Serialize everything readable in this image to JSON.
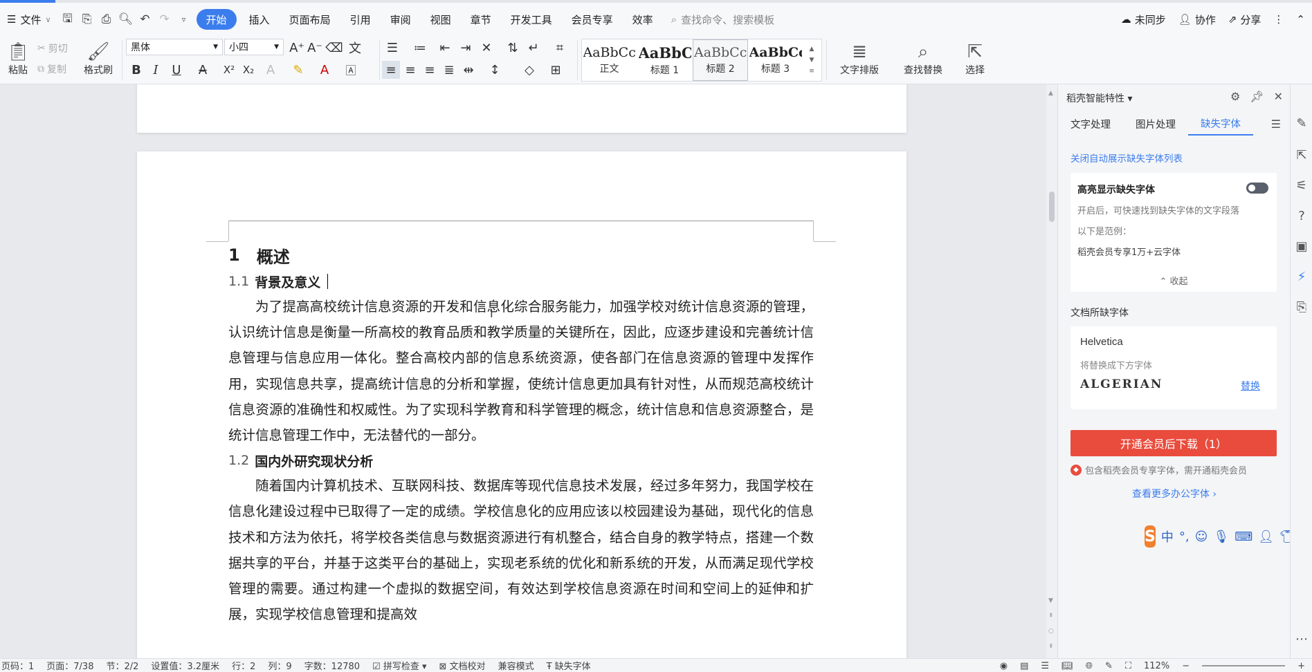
{
  "topbar": {
    "file_label": "文件",
    "tabs": [
      "开始",
      "插入",
      "页面布局",
      "引用",
      "审阅",
      "视图",
      "章节",
      "开发工具",
      "会员专享",
      "效率"
    ],
    "search_placeholder": "查找命令、搜索模板",
    "sync": "未同步",
    "collab": "协作",
    "share": "分享"
  },
  "ribbon": {
    "paste": "粘贴",
    "cut": "剪切",
    "copy": "复制",
    "format_painter": "格式刷",
    "font_name": "黑体",
    "font_size": "小四",
    "styles": [
      {
        "sample": "AaBbCcI",
        "label": "正文"
      },
      {
        "sample": "AaBbCc",
        "label": "标题 1"
      },
      {
        "sample": "AaBbCcD",
        "label": "标题 2"
      },
      {
        "sample": "AaBbCcI",
        "label": "标题 3"
      }
    ],
    "text_layout": "文字排版",
    "find_replace": "查找替换",
    "select": "选择"
  },
  "document": {
    "h1_num": "1",
    "h1_text": "概述",
    "s1_num": "1.1",
    "s1_text": "背景及意义",
    "p1": "为了提高高校统计信息资源的开发和信息化综合服务能力，加强学校对统计信息资源的管理，认识统计信息是衡量一所高校的教育品质和教学质量的关键所在，因此，应逐步建设和完善统计信息管理与信息应用一体化。整合高校内部的信息系统资源，使各部门在信息资源的管理中发挥作用，实现信息共享，提高统计信息的分析和掌握，使统计信息更加具有针对性，从而规范高校统计信息资源的准确性和权威性。为了实现科学教育和科学管理的概念，统计信息和信息资源整合，是统计信息管理工作中，无法替代的一部分。",
    "s2_num": "1.2",
    "s2_text": "国内外研究现状分析",
    "p2": "随着国内计算机技术、互联网科技、数据库等现代信息技术发展，经过多年努力，我国学校在信息化建设过程中已取得了一定的成绩。学校信息化的应用应该以校园建设为基础，现代化的信息技术和方法为依托，将学校各类信息与数据资源进行有机整合，结合自身的教学特点，搭建一个数据共享的平台，并基于这类平台的基础上，实现老系统的优化和新系统的开发，从而满足现代学校管理的需要。通过构建一个虚拟的数据空间，有效达到学校信息资源在时间和空间上的延伸和扩展，实现学校信息管理和提高效"
  },
  "panel": {
    "title": "稻壳智能特性",
    "tabs": [
      "文字处理",
      "图片处理",
      "缺失字体"
    ],
    "close_auto_link": "关闭自动展示缺失字体列表",
    "highlight_title": "高亮显示缺失字体",
    "highlight_desc": "开启后，可快速找到缺失字体的文字段落",
    "example_label": "以下是范例：",
    "example_text": "稻壳会员专享1万+云字体",
    "collapse": "收起",
    "missing_title": "文档所缺字体",
    "missing_font": "Helvetica",
    "replace_hint": "将替换成下方字体",
    "replacement_font": "ALGERIAN",
    "replace_btn": "替换",
    "download_btn": "开通会员后下载（1）",
    "member_note": "包含稻壳会员专享字体，需开通稻壳会员",
    "more_fonts": "查看更多办公字体 ›"
  },
  "ime": {
    "lang": "中"
  },
  "status": {
    "page_no": "页码：1",
    "page_of": "页面：7/38",
    "section": "节：2/2",
    "setting": "设置值：3.2厘米",
    "row": "行：2",
    "col": "列：9",
    "word_count": "字数：12780",
    "spell": "拼写检查",
    "doc_check": "文档校对",
    "compat": "兼容模式",
    "missing_font": "缺失字体",
    "zoom": "112%"
  }
}
